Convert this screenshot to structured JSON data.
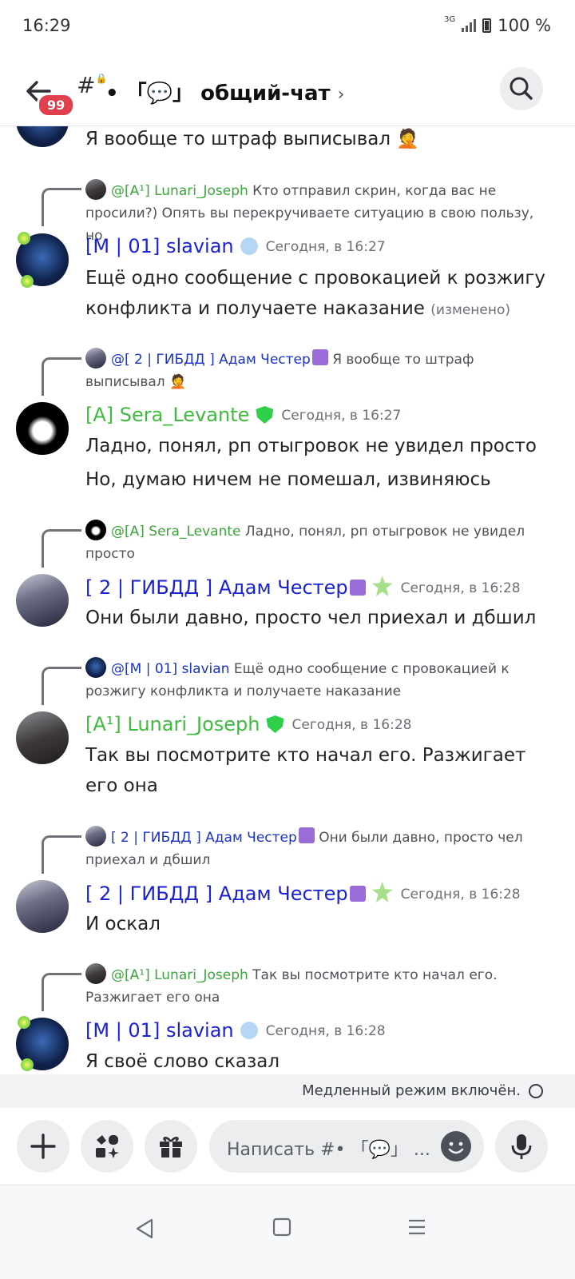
{
  "status": {
    "time": "16:29",
    "network": "3G",
    "battery": "100 %"
  },
  "header": {
    "badge": "99",
    "channel_name": "общий-чат",
    "channel_prefix": "#",
    "chevron": "›"
  },
  "messages": [
    {
      "id": "m0",
      "text": "Я вообще то штраф выписывал 🤦"
    },
    {
      "id": "m1",
      "reply": {
        "author": "@[A¹] Lunari_Joseph",
        "text": "Кто отправил скрин, когда вас не просили?) Опять вы перекручиваете ситуацию в свою пользу, но"
      },
      "author": "[M | 01] slavian",
      "timestamp": "Сегодня, в 16:27",
      "text": "Ещё одно сообщение с провокацией к розжигу конфликта и получаете наказание",
      "edited": "(изменено)"
    },
    {
      "id": "m2",
      "reply": {
        "author": "@[ 2 | ГИБДД ] Адам Честер",
        "text": "Я вообще то штраф выписывал 🤦"
      },
      "author": "[A] Sera_Levante",
      "timestamp": "Сегодня, в 16:27",
      "lines": [
        "Ладно, понял, рп отыгровок не увидел просто",
        "Но, думаю ничем не помешал, извиняюсь"
      ]
    },
    {
      "id": "m3",
      "reply": {
        "author": "@[A] Sera_Levante",
        "text": "Ладно, понял, рп отыгровок не увидел просто"
      },
      "author": "[ 2 | ГИБДД ] Адам Честер",
      "timestamp": "Сегодня, в 16:28",
      "text": "Они были давно, просто чел приехал и дбшил"
    },
    {
      "id": "m4",
      "reply": {
        "author": "@[M | 01] slavian",
        "text": "Ещё одно сообщение с провокацией к розжигу конфликта и получаете наказание"
      },
      "author": "[A¹] Lunari_Joseph",
      "timestamp": "Сегодня, в 16:28",
      "text": "Так вы посмотрите кто начал его. Разжигает его она"
    },
    {
      "id": "m5",
      "reply": {
        "author": "[ 2 | ГИБДД ] Адам Честер",
        "text": "Они были давно, просто чел приехал и дбшил"
      },
      "author": "[ 2 | ГИБДД ] Адам Честер",
      "timestamp": "Сегодня, в 16:28",
      "text": "И оскал"
    },
    {
      "id": "m6",
      "reply": {
        "author": "@[A¹] Lunari_Joseph",
        "text": "Так вы посмотрите кто начал его. Разжигает его она"
      },
      "author": "[M | 01] slavian",
      "timestamp": "Сегодня, в 16:28",
      "text": "Я своё слово сказал"
    }
  ],
  "slowmode": "Медленный режим включён.",
  "composer": {
    "placeholder": "Написать #• 「💬」 ..."
  },
  "icons": {
    "back": "arrow-left-icon",
    "search": "search-icon",
    "plus": "plus-icon",
    "apps": "apps-icon",
    "gift": "gift-icon",
    "emoji": "emoji-icon",
    "mic": "mic-icon"
  }
}
